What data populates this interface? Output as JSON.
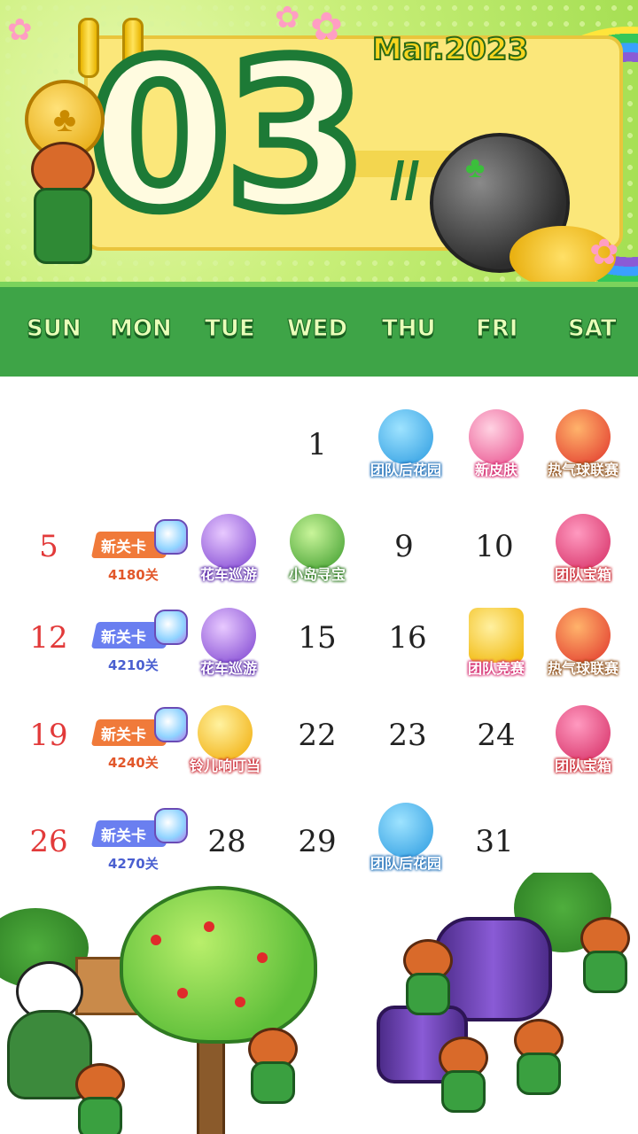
{
  "header": {
    "month_number": "03",
    "month_label": "Mar.2023",
    "weekdays": [
      "SUN",
      "MON",
      "TUE",
      "WED",
      "THU",
      "FRI",
      "SAT"
    ]
  },
  "calendar": {
    "days": {
      "d1": "1",
      "d5": "5",
      "d9": "9",
      "d10": "10",
      "d12": "12",
      "d15": "15",
      "d16": "16",
      "d19": "19",
      "d22": "22",
      "d23": "23",
      "d24": "24",
      "d26": "26",
      "d28": "28",
      "d29": "29",
      "d31": "31"
    },
    "events": {
      "d2": "团队后花园",
      "d3": "新皮肤",
      "d4": "热气球联赛",
      "d6": {
        "title": "新关卡",
        "sub": "4180关"
      },
      "d7": "花车巡游",
      "d8": "小岛寻宝",
      "d11": "团队宝箱",
      "d13": {
        "title": "新关卡",
        "sub": "4210关"
      },
      "d14": "花车巡游",
      "d17": "团队竞赛",
      "d18": "热气球联赛",
      "d20": {
        "title": "新关卡",
        "sub": "4240关"
      },
      "d21": "铃儿响叮当",
      "d25": "团队宝箱",
      "d27": {
        "title": "新关卡",
        "sub": "4270关"
      },
      "d30": "团队后花园"
    }
  },
  "colors": {
    "header_green": "#3ea447",
    "sunday_red": "#e23a3a",
    "ribbon_orange": "#f07a3a",
    "ribbon_blue": "#6a7ff0"
  }
}
